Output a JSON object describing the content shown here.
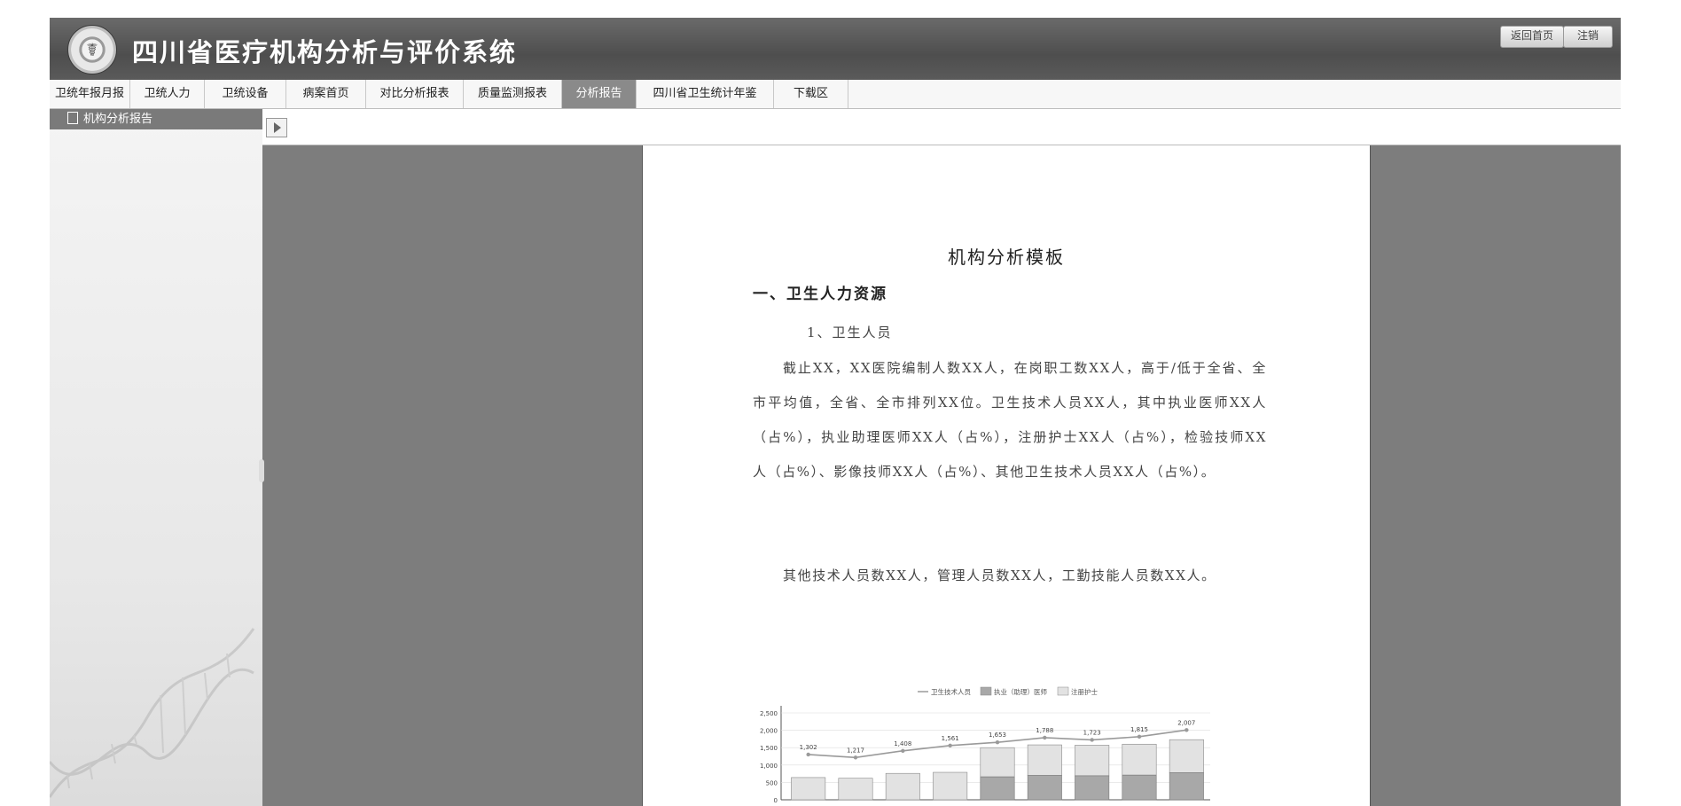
{
  "header": {
    "title": "四川省医疗机构分析与评价系统",
    "home_btn": "返回首页",
    "logout_btn": "注销"
  },
  "nav": {
    "tabs": [
      "卫统年报月报",
      "卫统人力",
      "卫统设备",
      "病案首页",
      "对比分析报表",
      "质量监测报表",
      "分析报告",
      "四川省卫生统计年鉴",
      "下载区"
    ],
    "active": "分析报告"
  },
  "sidebar": {
    "heading": "机构分析报告"
  },
  "document": {
    "title": "机构分析模板",
    "section1": "一、卫生人力资源",
    "sub1": "1、卫生人员",
    "para1": "截止XX，XX医院编制人数XX人，在岗职工数XX人，高于/低于全省、全市平均值，全省、全市排列XX位。卫生技术人员XX人，其中执业医师XX人（占%），执业助理医师XX人（占%），注册护士XX人（占%），检验技师XX人（占%）、影像技师XX人（占%）、其他卫生技术人员XX人（占%）。",
    "para2": "其他技术人员数XX人，管理人员数XX人，工勤技能人员数XX人。"
  },
  "chart_data": {
    "type": "bar",
    "legend": [
      "卫生技术人员",
      "执业（助理）医师",
      "注册护士"
    ],
    "ylim": [
      0,
      2500
    ],
    "yticks": [
      "2,500",
      "2,000",
      "1,500",
      "1,000",
      "500",
      "0"
    ],
    "series": [
      {
        "name": "卫生技术人员",
        "type": "line",
        "values": [
          1302,
          1217,
          1408,
          1561,
          1653,
          1788,
          1723,
          1815,
          2007
        ],
        "labels": [
          "1,302",
          "1,217",
          "1,408",
          "1,561",
          "1,653",
          "1,788",
          "1,723",
          "1,815",
          "2,007"
        ]
      },
      {
        "name": "执业（助理）医师",
        "type": "bar",
        "values": [
          0,
          0,
          0,
          0,
          660,
          700,
          690,
          710,
          780
        ]
      },
      {
        "name": "注册护士",
        "type": "bar",
        "values": [
          640,
          620,
          760,
          790,
          840,
          880,
          880,
          890,
          950
        ]
      }
    ],
    "colors": {
      "line": "#9a9a9a",
      "doctors": "#a8a8a8",
      "nurses": "#e2e2e2"
    }
  }
}
